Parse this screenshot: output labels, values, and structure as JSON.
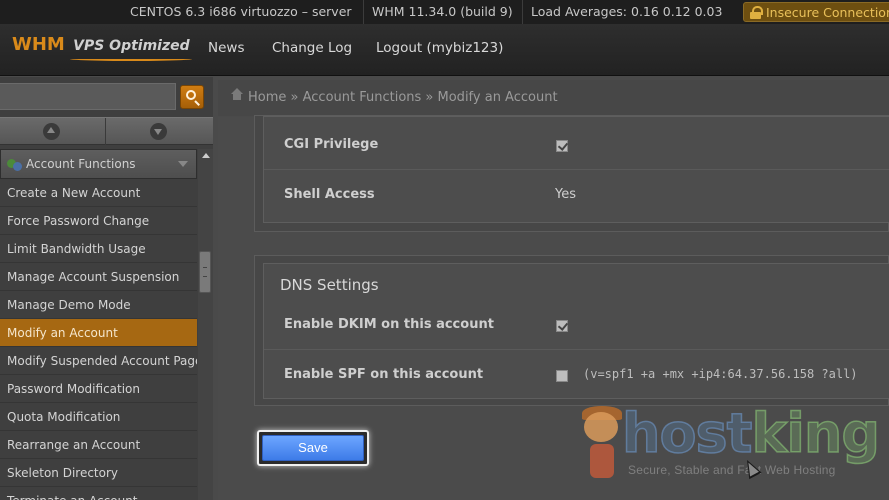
{
  "statusbar": {
    "server": "CENTOS 6.3 i686 virtuozzo – server",
    "whm_version": "WHM 11.34.0 (build 9)",
    "load_averages": "Load Averages: 0.16 0.12 0.03",
    "insecure": "Insecure Connection"
  },
  "header": {
    "logo_main": "WHM",
    "logo_sub": "VPS Optimized",
    "nav": [
      "News",
      "Change Log",
      "Logout (mybiz123)"
    ]
  },
  "sidebar": {
    "search_placeholder": "",
    "section_title": "Account Functions",
    "items": [
      "Create a New Account",
      "Force Password Change",
      "Limit Bandwidth Usage",
      "Manage Account Suspension",
      "Manage Demo Mode",
      "Modify an Account",
      "Modify Suspended Account Page",
      "Password Modification",
      "Quota Modification",
      "Rearrange an Account",
      "Skeleton Directory",
      "Terminate an Account"
    ],
    "active_index": 5
  },
  "breadcrumb": {
    "text": "Home » Account Functions » Modify an Account"
  },
  "privileges": {
    "rows": [
      {
        "label": "CGI Privilege",
        "checked": true
      },
      {
        "label": "Shell Access",
        "value": "Yes"
      }
    ]
  },
  "dns": {
    "title": "DNS Settings",
    "dkim_label": "Enable DKIM on this account",
    "dkim_checked": true,
    "spf_label": "Enable SPF on this account",
    "spf_checked": false,
    "spf_record": "(v=spf1 +a +mx +ip4:64.37.56.158 ?all)"
  },
  "actions": {
    "save_label": "Save"
  },
  "watermark": {
    "host": "host",
    "king": "king",
    "tagline": "Secure, Stable and Fast Web Hosting"
  },
  "colors": {
    "accent": "#a66812",
    "save_button": "#4a88f0"
  }
}
